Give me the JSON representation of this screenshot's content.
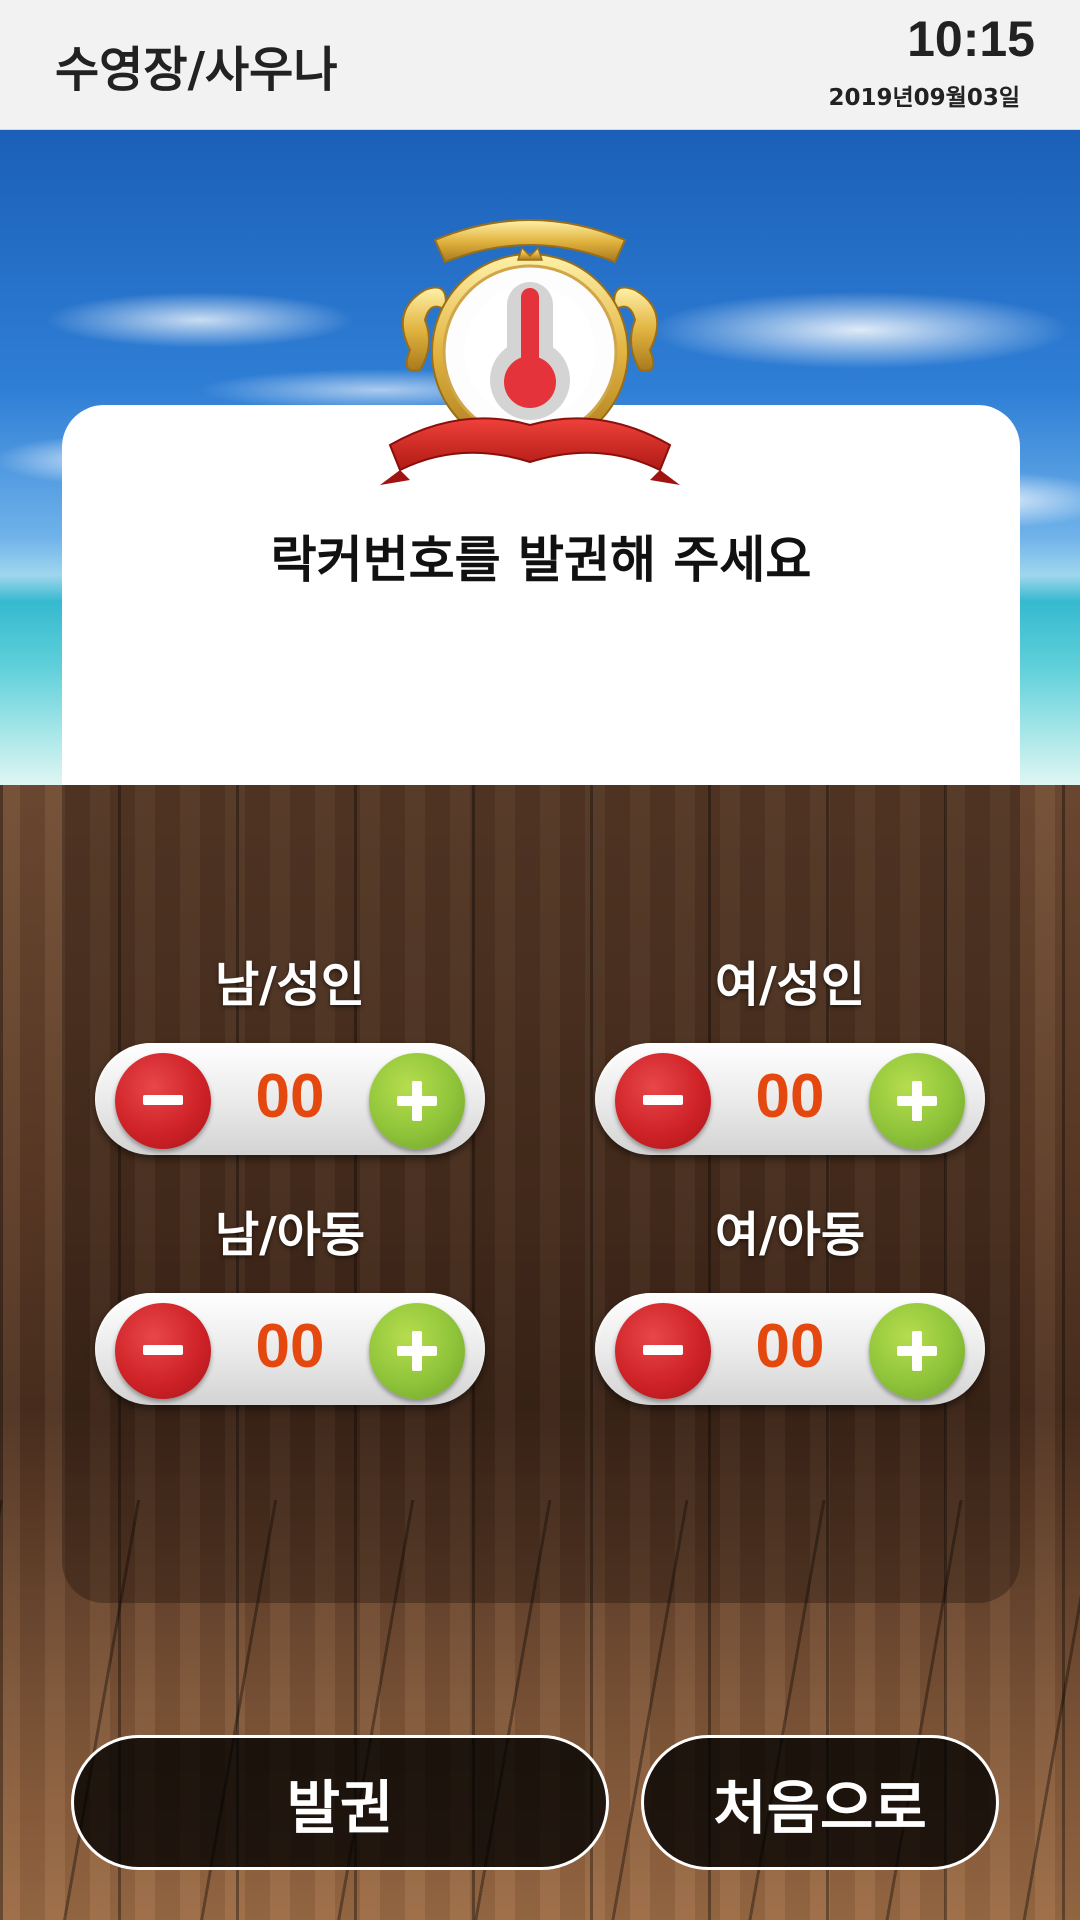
{
  "header": {
    "title": "수영장/사우나",
    "time": "10:15",
    "date": "2019년09월03일"
  },
  "card": {
    "instruction": "락커번호를 발권해 주세요"
  },
  "counters": [
    {
      "label": "남/성인",
      "value": "00",
      "minus": "−",
      "plus": "+"
    },
    {
      "label": "여/성인",
      "value": "00",
      "minus": "−",
      "plus": "+"
    },
    {
      "label": "남/아동",
      "value": "00",
      "minus": "−",
      "plus": "+"
    },
    {
      "label": "여/아동",
      "value": "00",
      "minus": "−",
      "plus": "+"
    }
  ],
  "actions": {
    "issue_label": "발권",
    "home_label": "처음으로"
  },
  "icons": {
    "emblem": "thermometer-emblem-icon",
    "minus": "minus-icon",
    "plus": "plus-icon"
  },
  "colors": {
    "count_text": "#e5480e",
    "minus_button": "#cf2328",
    "plus_button": "#8fc43a"
  }
}
